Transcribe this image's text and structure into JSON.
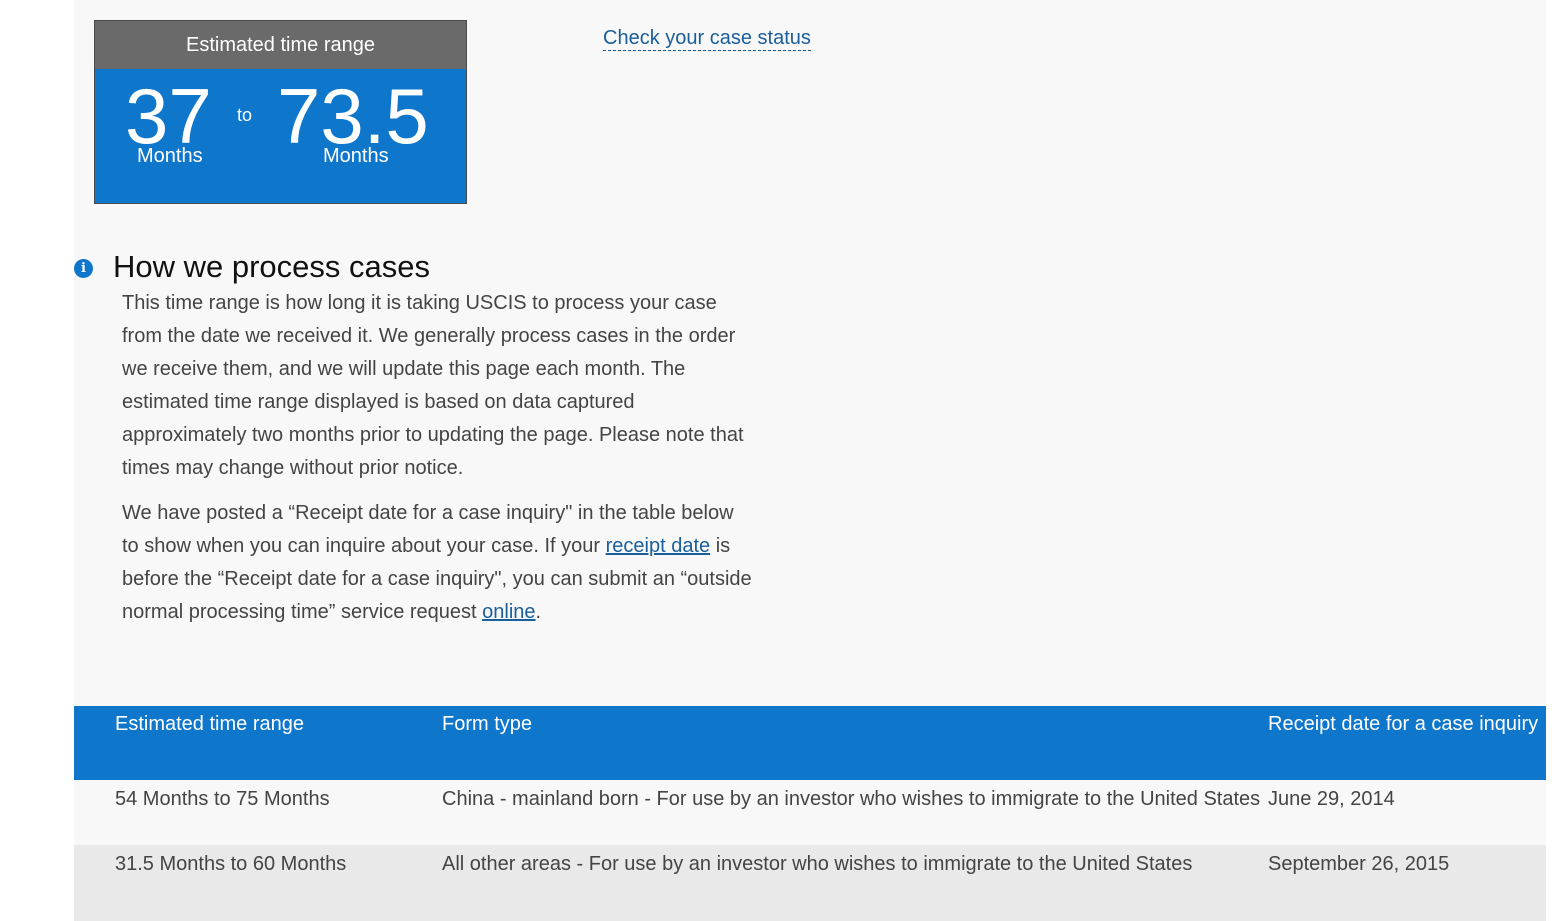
{
  "estimate": {
    "header": "Estimated time range",
    "min_value": "37",
    "min_unit": "Months",
    "to_word": "to",
    "max_value": "73.5",
    "max_unit": "Months"
  },
  "case_status_link": "Check your case status",
  "process": {
    "icon": "info-icon",
    "title": "How we process cases",
    "paragraph_1": "This time range is how long it is taking USCIS to process your case from the date we received it. We generally process cases in the order we receive them, and we will update this page each month. The estimated time range displayed is based on data captured approximately two months prior to updating the page. Please note that times may change without prior notice.",
    "paragraph_2_part_1": "We have posted a “Receipt date for a case inquiry\" in the table below to show when you can inquire about your case. If your ",
    "paragraph_2_link_1": "receipt date",
    "paragraph_2_part_2": " is before the “Receipt date for a case inquiry\", you can submit an “outside normal processing time” service request ",
    "paragraph_2_link_2": "online",
    "paragraph_2_part_3": "."
  },
  "table": {
    "headers": [
      "Estimated time range",
      "Form type",
      "Receipt date for a case inquiry"
    ],
    "rows": [
      {
        "range": "54 Months to 75 Months",
        "form": "China - mainland born - For use by an investor who wishes to immigrate to the United States",
        "date": "June 29, 2014"
      },
      {
        "range": "31.5 Months to 60 Months",
        "form": "All other areas - For use by an investor who wishes to immigrate to the United States",
        "date": "September 26, 2015"
      }
    ]
  },
  "colors": {
    "brand_blue": "#0e77cc",
    "header_gray": "#6a6a6a",
    "link_blue": "#1a5e9a"
  }
}
